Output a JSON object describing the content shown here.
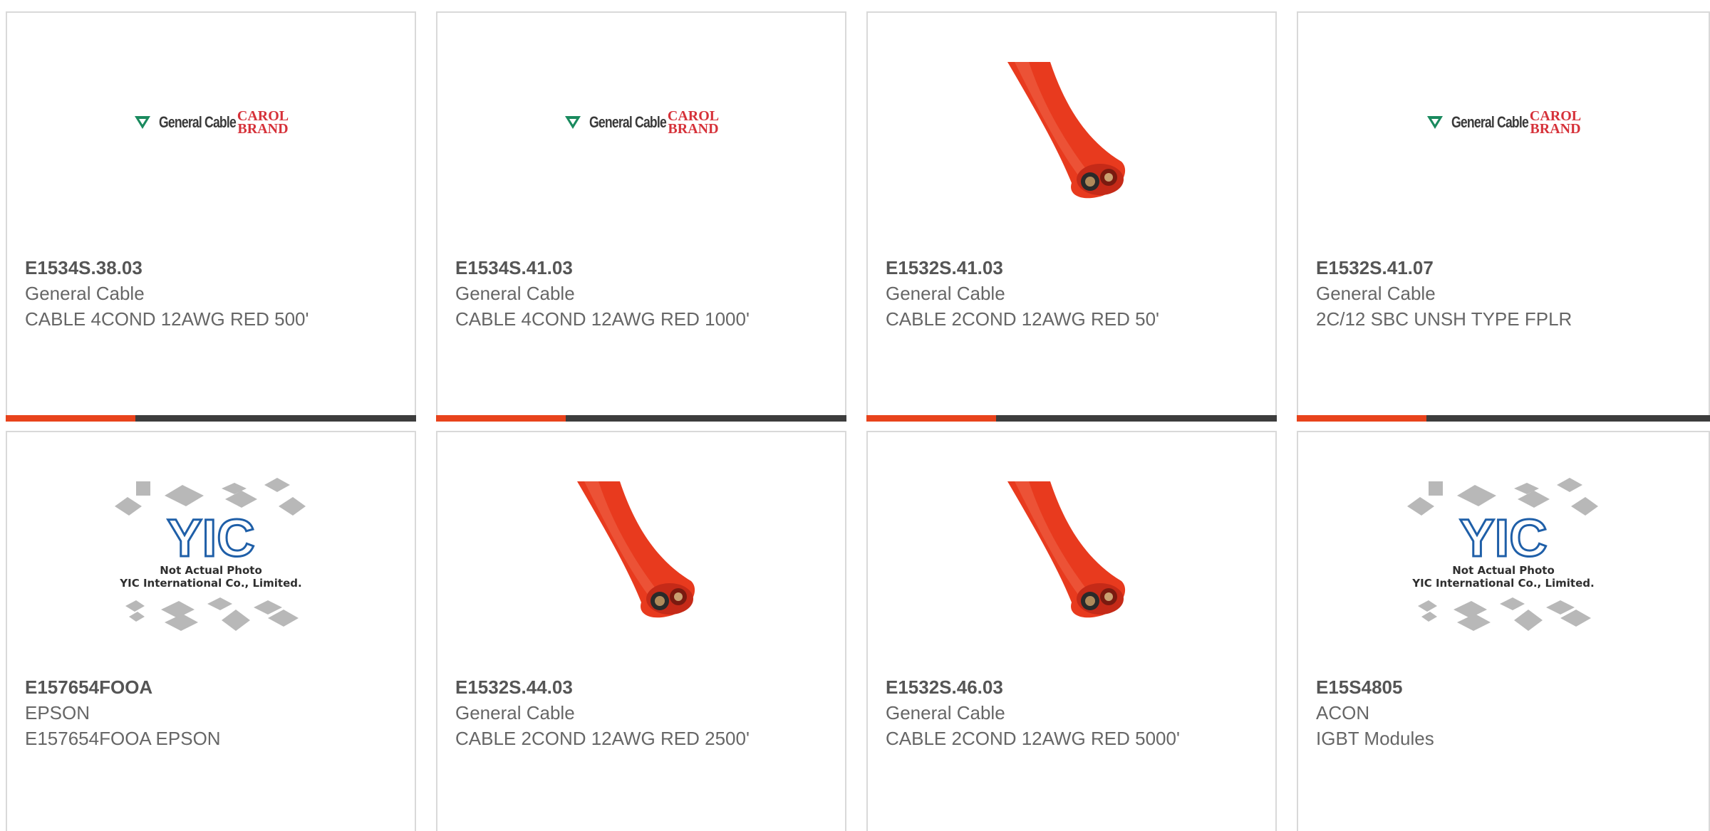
{
  "cards": [
    {
      "part": "E1534S.38.03",
      "mfr": "General Cable",
      "desc": "CABLE 4COND 12AWG RED 500'",
      "image": "general-cable-carol-logo",
      "has_bar": true
    },
    {
      "part": "E1534S.41.03",
      "mfr": "General Cable",
      "desc": "CABLE 4COND 12AWG RED 1000'",
      "image": "general-cable-carol-logo",
      "has_bar": true
    },
    {
      "part": "E1532S.41.03",
      "mfr": "General Cable",
      "desc": "CABLE 2COND 12AWG RED 50'",
      "image": "red-cable-photo",
      "has_bar": true
    },
    {
      "part": "E1532S.41.07",
      "mfr": "General Cable",
      "desc": "2C/12 SBC UNSH TYPE FPLR",
      "image": "general-cable-carol-logo",
      "has_bar": true
    },
    {
      "part": "E157654FOOA",
      "mfr": "EPSON",
      "desc": "E157654FOOA EPSON",
      "image": "yic-placeholder",
      "has_bar": false
    },
    {
      "part": "E1532S.44.03",
      "mfr": "General Cable",
      "desc": "CABLE 2COND 12AWG RED 2500'",
      "image": "red-cable-photo",
      "has_bar": false
    },
    {
      "part": "E1532S.46.03",
      "mfr": "General Cable",
      "desc": "CABLE 2COND 12AWG RED 5000'",
      "image": "red-cable-photo",
      "has_bar": false
    },
    {
      "part": "E15S4805",
      "mfr": "ACON",
      "desc": "IGBT Modules",
      "image": "yic-placeholder",
      "has_bar": false
    }
  ],
  "logo": {
    "general_cable": "General Cable",
    "carol_line1": "CAROL",
    "carol_line2": "BRAND"
  },
  "placeholder": {
    "line1": "Not Actual Photo",
    "line2": "YIC International Co., Limited.",
    "brand": "YIC"
  },
  "colors": {
    "accent": "#e8431c",
    "bar": "#3d3d3d",
    "border": "#d9d9d9",
    "part_text": "#555555",
    "body_text": "#666666",
    "cable_red": "#e83a1e",
    "yic_blue": "#1f5fa8"
  }
}
